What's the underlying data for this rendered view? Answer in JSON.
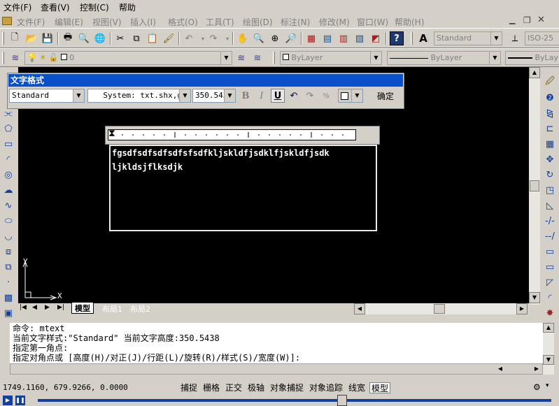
{
  "menubar": {
    "outer": [
      {
        "label": "文件(F)"
      },
      {
        "label": "查看(V)"
      },
      {
        "label": "控制(C)"
      },
      {
        "label": "帮助"
      }
    ],
    "inner": [
      {
        "label": "文件(F)"
      },
      {
        "label": "编辑(E)"
      },
      {
        "label": "视图(V)"
      },
      {
        "label": "插入(I)"
      },
      {
        "label": "格式(O)"
      },
      {
        "label": "工具(T)"
      },
      {
        "label": "绘图(D)"
      },
      {
        "label": "标注(N)"
      },
      {
        "label": "修改(M)"
      },
      {
        "label": "窗口(W)"
      },
      {
        "label": "帮助(H)"
      }
    ]
  },
  "toolbar": {
    "text_style_combo": "Standard",
    "dim_style_combo": "ISO-25"
  },
  "layers": {
    "layer_value": "0",
    "color_value": "ByLayer",
    "linetype_value": "ByLayer",
    "lineweight_value": "ByLay"
  },
  "text_format": {
    "title": "文字格式",
    "style": "Standard",
    "font": "System: txt.shx,gb",
    "height": "350.543",
    "bold": "B",
    "italic": "I",
    "underline": "U",
    "ok_label": "确定"
  },
  "mtext": {
    "line1": "fgsdfsdfsdfsdfsfsdfkljskldfjsdklfjskldfjsdk",
    "line2": "ljkldsjflksdjk"
  },
  "ucs": {
    "y_label": "Y",
    "x_label": "X"
  },
  "layout_tabs": [
    {
      "label": "模型"
    },
    {
      "label": "布局1"
    },
    {
      "label": "布局2"
    }
  ],
  "command": {
    "lines": [
      "命令: mtext",
      "当前文字样式:\"Standard\"  当前文字高度:350.5438",
      "指定第一角点:",
      "指定对角点或 [高度(H)/对正(J)/行距(L)/旋转(R)/样式(S)/宽度(W)]:"
    ]
  },
  "status": {
    "coords": "1749.1160, 679.9266, 0.0000",
    "toggles": [
      {
        "label": "捕捉"
      },
      {
        "label": "栅格"
      },
      {
        "label": "正交"
      },
      {
        "label": "极轴"
      },
      {
        "label": "对象捕捉"
      },
      {
        "label": "对象追踪"
      },
      {
        "label": "线宽"
      },
      {
        "label": "模型"
      }
    ]
  },
  "colors": {
    "canvas": "#000000",
    "dialog_title": "#0a50c8",
    "ui": "#d4d0c8"
  }
}
